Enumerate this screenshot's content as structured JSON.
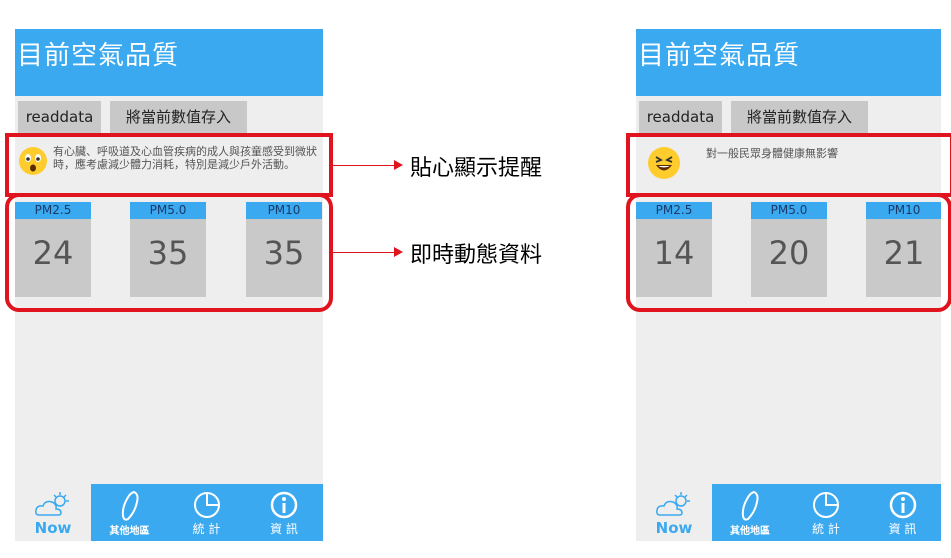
{
  "left": {
    "title": "目前空氣品質",
    "buttons": {
      "read": "readdata",
      "save": "將當前數值存入"
    },
    "alert": "有心臟、呼吸道及心血管疾病的成人與孩童感受到微狀時，應考慮減少體力消耗，特別是減少戶外活動。",
    "pm": [
      {
        "label": "PM2.5",
        "value": "24"
      },
      {
        "label": "PM5.0",
        "value": "35"
      },
      {
        "label": "PM10",
        "value": "35"
      }
    ]
  },
  "right": {
    "title": "目前空氣品質",
    "buttons": {
      "read": "readdata",
      "save": "將當前數值存入"
    },
    "alert": "對一般民眾身體健康無影響",
    "pm": [
      {
        "label": "PM2.5",
        "value": "14"
      },
      {
        "label": "PM5.0",
        "value": "20"
      },
      {
        "label": "PM10",
        "value": "21"
      }
    ]
  },
  "tabs": {
    "now": "Now",
    "regions": "其他地區",
    "stats": "統 計",
    "info": "資 訊"
  },
  "callouts": {
    "alert": "貼心顯示提醒",
    "data": "即時動態資料"
  },
  "colors": {
    "header": "#3ba9ef",
    "highlight": "#e0141e",
    "value_box": "#c9c9c9"
  },
  "icons": {
    "left_alert": "surprised-face-icon",
    "right_alert": "laughing-face-icon"
  }
}
